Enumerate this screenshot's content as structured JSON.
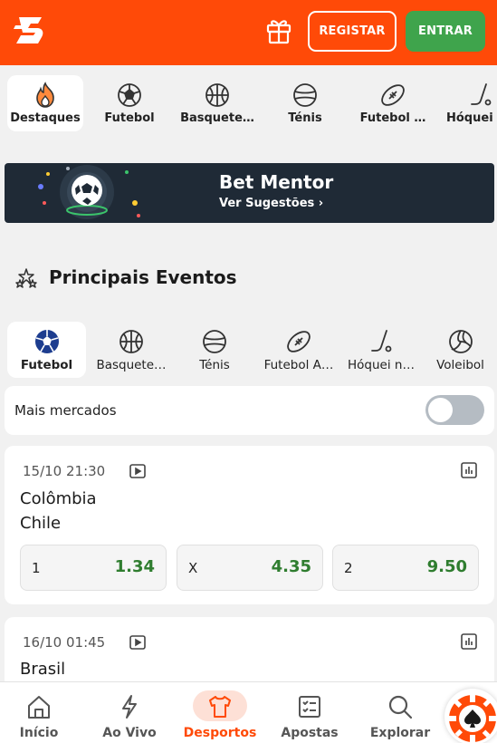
{
  "header": {
    "register_label": "REGISTAR",
    "login_label": "ENTRAR",
    "brand_color": "#ff4a08",
    "login_color": "#3fa44c"
  },
  "top_sports": [
    {
      "label": "Destaques",
      "icon": "flame-icon",
      "active": true
    },
    {
      "label": "Futebol",
      "icon": "soccer-ball-icon",
      "active": false
    },
    {
      "label": "Basquete…",
      "icon": "basketball-icon",
      "active": false
    },
    {
      "label": "Ténis",
      "icon": "tennis-ball-icon",
      "active": false
    },
    {
      "label": "Futebol …",
      "icon": "american-football-icon",
      "active": false
    },
    {
      "label": "Hóquei n",
      "icon": "hockey-stick-icon",
      "active": false
    }
  ],
  "mentor": {
    "title": "Bet Mentor",
    "subtitle": "Ver Sugestões ›"
  },
  "section": {
    "title": "Principais Eventos"
  },
  "event_sports": [
    {
      "label": "Futebol",
      "icon": "soccer-ball-icon",
      "active": true
    },
    {
      "label": "Basquete…",
      "icon": "basketball-icon",
      "active": false
    },
    {
      "label": "Ténis",
      "icon": "tennis-ball-icon",
      "active": false
    },
    {
      "label": "Futebol A…",
      "icon": "american-football-icon",
      "active": false
    },
    {
      "label": "Hóquei n…",
      "icon": "hockey-stick-icon",
      "active": false
    },
    {
      "label": "Voleibol",
      "icon": "volleyball-icon",
      "active": false
    }
  ],
  "more_markets": {
    "label": "Mais mercados",
    "enabled": false
  },
  "events": [
    {
      "date": "15/10 21:30",
      "home": "Colômbia",
      "away": "Chile",
      "odds": [
        {
          "key": "1",
          "value": "1.34"
        },
        {
          "key": "X",
          "value": "4.35"
        },
        {
          "key": "2",
          "value": "9.50"
        }
      ]
    },
    {
      "date": "16/10 01:45",
      "home": "Brasil"
    }
  ],
  "bottom_nav": [
    {
      "label": "Início",
      "icon": "home-icon",
      "active": false
    },
    {
      "label": "Ao Vivo",
      "icon": "lightning-icon",
      "active": false
    },
    {
      "label": "Desportos",
      "icon": "jersey-icon",
      "active": true
    },
    {
      "label": "Apostas",
      "icon": "betslip-icon",
      "active": false
    },
    {
      "label": "Explorar",
      "icon": "search-icon",
      "active": false
    }
  ]
}
